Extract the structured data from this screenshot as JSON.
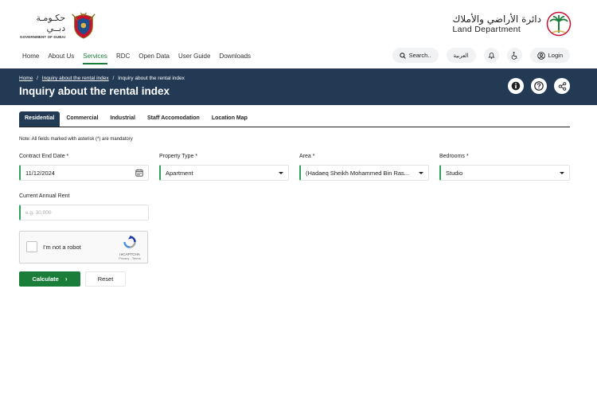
{
  "logos": {
    "gov_ar": "حكـومـة دبــي",
    "gov_en": "GOVERNMENT OF DUBAI",
    "ld_ar": "دائرة الأراضي والأملاك",
    "ld_en": "Land Department"
  },
  "nav": {
    "items": [
      {
        "label": "Home"
      },
      {
        "label": "About Us"
      },
      {
        "label": "Services"
      },
      {
        "label": "RDC"
      },
      {
        "label": "Open Data"
      },
      {
        "label": "User Guide"
      },
      {
        "label": "Downloads"
      }
    ],
    "active": "Services",
    "search_label": "Search..",
    "arabic_label": "العربية",
    "login_label": "Login"
  },
  "banner": {
    "crumbs": [
      "Home",
      "/",
      "Inquiry about the rental index",
      "/",
      "Inquiry about the rental index"
    ],
    "title": "Inquiry about the rental index"
  },
  "tabs": [
    {
      "label": "Residential"
    },
    {
      "label": "Commercial"
    },
    {
      "label": "Industrial"
    },
    {
      "label": "Staff Accomodation"
    },
    {
      "label": "Location Map"
    }
  ],
  "note": "Note: All fields marked with asterisk (*) are mandatory",
  "form": {
    "contract_end_date": {
      "label": "Contract End Date *",
      "value": "11/12/2024"
    },
    "property_type": {
      "label": "Property Type *",
      "value": "Apartment"
    },
    "area": {
      "label": "Area *",
      "value": "(Hadaeq Sheikh Mohammed Bin Ras..."
    },
    "bedrooms": {
      "label": "Bedrooms *",
      "value": "Studio"
    },
    "annual_rent": {
      "label": "Current Annual Rent",
      "placeholder": "e.g. 30,000"
    }
  },
  "captcha": {
    "label": "I'm not a robot",
    "brand": "reCAPTCHA",
    "links": "Privacy - Terms"
  },
  "buttons": {
    "calculate": "Calculate",
    "calculate_arrow": "›",
    "reset": "Reset"
  },
  "colors": {
    "accent_green": "#1a7d3a",
    "banner_navy": "#233a55"
  }
}
